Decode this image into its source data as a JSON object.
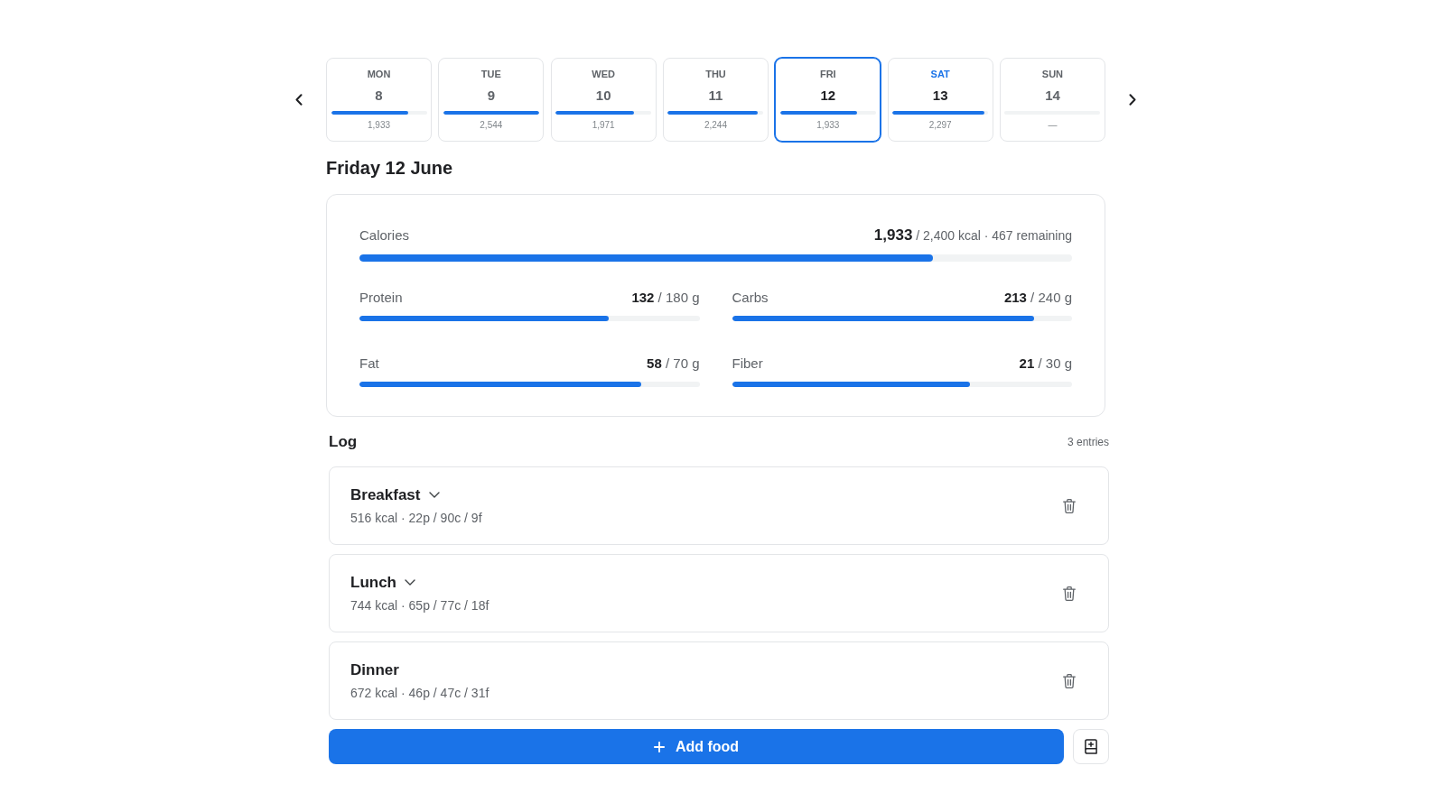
{
  "week": {
    "days": [
      {
        "weekday": "MON",
        "date": "8",
        "kcal": "1,933",
        "level": 0.805,
        "selected": false,
        "today": false
      },
      {
        "weekday": "TUE",
        "date": "9",
        "kcal": "2,544",
        "level": 1,
        "selected": false,
        "today": false
      },
      {
        "weekday": "WED",
        "date": "10",
        "kcal": "1,971",
        "level": 0.82,
        "selected": false,
        "today": false
      },
      {
        "weekday": "THU",
        "date": "11",
        "kcal": "2,244",
        "level": 0.935,
        "selected": false,
        "today": false
      },
      {
        "weekday": "FRI",
        "date": "12",
        "kcal": "1,933",
        "level": 0.805,
        "selected": true,
        "today": false
      },
      {
        "weekday": "SAT",
        "date": "13",
        "kcal": "2,297",
        "level": 0.957,
        "selected": false,
        "today": true
      },
      {
        "weekday": "SUN",
        "date": "14",
        "kcal": "—",
        "level": 0,
        "selected": false,
        "today": false
      }
    ]
  },
  "day_title": "Friday 12 June",
  "summary": {
    "calories": {
      "label": "Calories",
      "reading": "**1,933** / 2,400 kcal · 467 remaining",
      "level": 0.805
    },
    "macros": [
      {
        "label": "Protein",
        "reading": "**132** / 180 g",
        "level": 0.733
      },
      {
        "label": "Carbs",
        "reading": "**213** / 240 g",
        "level": 0.8875
      },
      {
        "label": "Fat",
        "reading": "**58** / 70 g",
        "level": 0.829
      },
      {
        "label": "Fiber",
        "reading": "**21** / 30 g",
        "level": 0.7
      }
    ]
  },
  "log": {
    "title": "Log",
    "count": "3 entries",
    "entries": [
      {
        "name": "Breakfast",
        "expandable": true,
        "details": "516 kcal · 22p / 90c / 9f"
      },
      {
        "name": "Lunch",
        "expandable": true,
        "details": "744 kcal · 65p / 77c / 18f"
      },
      {
        "name": "Dinner",
        "expandable": false,
        "details": "672 kcal · 46p / 47c / 31f"
      }
    ]
  },
  "add_button": {
    "label": "Add food"
  }
}
